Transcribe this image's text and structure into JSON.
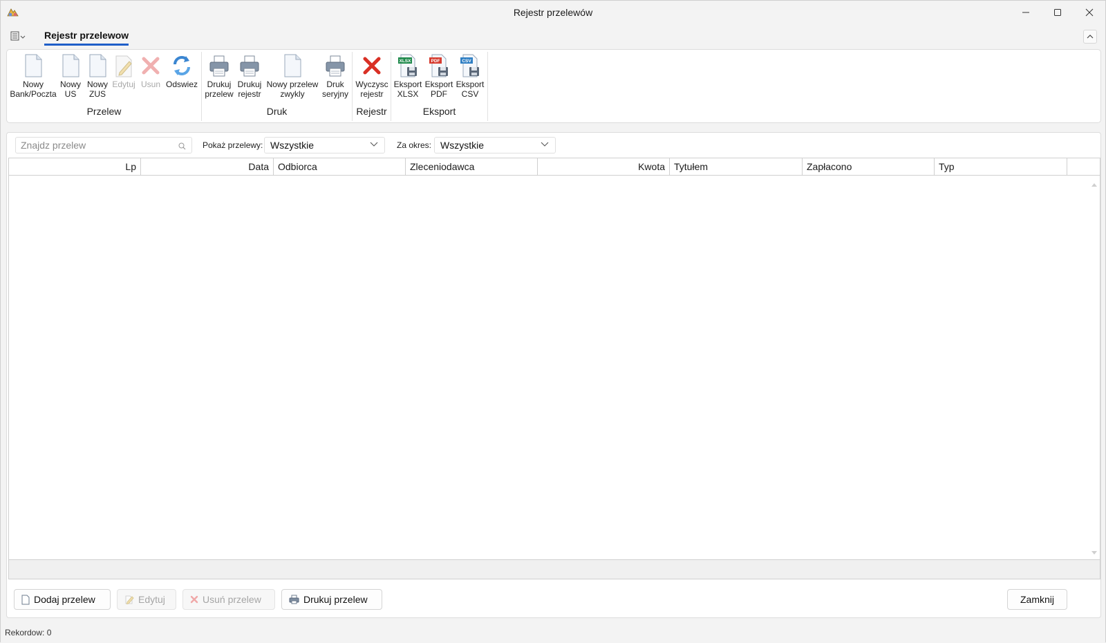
{
  "window": {
    "title": "Rejestr przelewów"
  },
  "ribbon": {
    "tab_label": "Rejestr przelewow",
    "groups": {
      "przelew": {
        "label": "Przelew",
        "buttons": {
          "nowy_bank": "Nowy\nBank/Poczta",
          "nowy_us": "Nowy\nUS",
          "nowy_zus": "Nowy\nZUS",
          "edytuj": "Edytuj",
          "usun": "Usun",
          "odswiez": "Odswiez"
        }
      },
      "druk": {
        "label": "Druk",
        "buttons": {
          "drukuj_przelew": "Drukuj\nprzelew",
          "drukuj_rejestr": "Drukuj\nrejestr",
          "nowy_przelew_zwykly": "Nowy przelew\nzwykly",
          "druk_seryjny": "Druk\nseryjny"
        }
      },
      "rejestr": {
        "label": "Rejestr",
        "buttons": {
          "wyczysc_rejestr": "Wyczysc\nrejestr"
        }
      },
      "eksport": {
        "label": "Eksport",
        "buttons": {
          "xlsx": "Eksport\nXLSX",
          "pdf": "Eksport\nPDF",
          "csv": "Eksport\nCSV"
        },
        "icon_tags": {
          "xlsx": "XLSX",
          "pdf": "PDF",
          "csv": "CSV"
        }
      }
    }
  },
  "filters": {
    "search_placeholder": "Znajdz przelew",
    "show_label": "Pokaż przelewy:",
    "show_value": "Wszystkie",
    "period_label": "Za okres:",
    "period_value": "Wszystkie"
  },
  "table": {
    "columns": [
      "Lp",
      "Data",
      "Odbiorca",
      "Zleceniodawca",
      "Kwota",
      "Tytułem",
      "Zapłacono",
      "Typ"
    ],
    "rows": []
  },
  "actions": {
    "add": "Dodaj przelew",
    "edit": "Edytuj",
    "delete": "Usuń przelew",
    "print": "Drukuj przelew",
    "close": "Zamknij"
  },
  "status": {
    "records": "Rekordow: 0"
  },
  "colors": {
    "accent": "#1e5ec8",
    "delete_red": "#d93025"
  }
}
